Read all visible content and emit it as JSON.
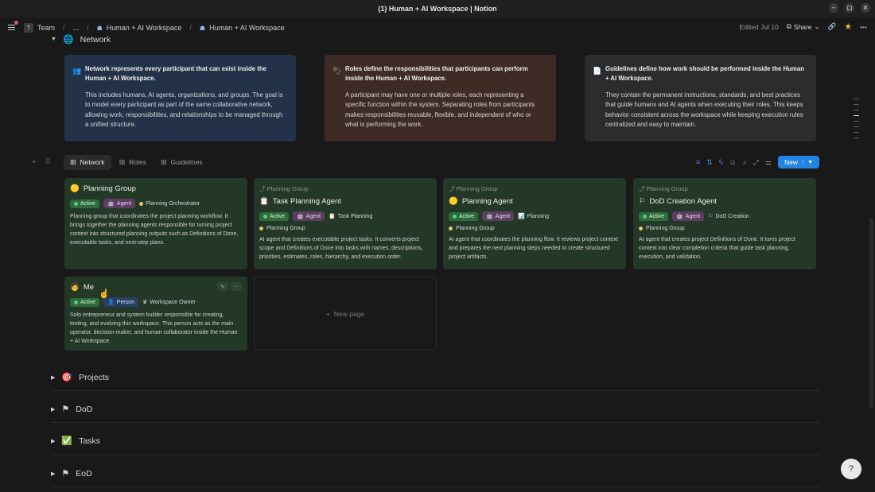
{
  "window": {
    "title": "(1) Human + AI Workspace | Notion"
  },
  "nav": {
    "team": "Team",
    "team_initial": "T",
    "ellipsis": "...",
    "crumb1": "Human + AI Workspace",
    "crumb2": "Human + AI Workspace",
    "edited": "Edited Jul 10",
    "share": "Share"
  },
  "network_section": {
    "label": "Network"
  },
  "callouts": [
    {
      "title": "Network represents every participant that can exist inside the Human + AI Workspace.",
      "body": "This includes humans, AI agents, organizations, and groups. The goal is to model every participant as part of the same collaborative network, allowing work, responsibilities, and relationships to be managed through a unified structure."
    },
    {
      "title": "Roles define the responsibilities that participants can perform inside the Human + AI Workspace.",
      "body": "A participant may have one or multiple roles, each representing a specific function within the system. Separating roles from participants makes responsibilities reusable, flexible, and independent of who or what is performing the work."
    },
    {
      "title": "Guidelines define how work should be performed inside the Human + AI Workspace.",
      "body": "They contain the permanent instructions, standards, and best practices that guide humans and AI agents when executing their roles. This keeps behavior consistent across the workspace while keeping execution rules centralized and easy to maintain."
    }
  ],
  "views": {
    "tab1": "Network",
    "tab2": "Roles",
    "tab3": "Guidelines",
    "new_button": "New"
  },
  "cards": [
    {
      "parent": "",
      "name": "Planning Group",
      "status": "Active",
      "type": "Agent",
      "role": "Planning Orchestrator",
      "group": "",
      "desc": "Planning group that coordinates the project planning workflow. It brings together the planning agents responsible for turning project context into structured planning outputs such as Definitions of Done, executable tasks, and next-step plans."
    },
    {
      "parent": "Planning Group",
      "name": "Task Planning Agent",
      "status": "Active",
      "type": "Agent",
      "role": "Task Planning",
      "group": "Planning Group",
      "desc": "AI agent that creates executable project tasks. It converts project scope and Definitions of Done into tasks with names, descriptions, priorities, estimates, roles, hierarchy, and execution order."
    },
    {
      "parent": "Planning Group",
      "name": "Planning Agent",
      "status": "Active",
      "type": "Agent",
      "role": "Planning",
      "group": "Planning Group",
      "desc": "AI agent that coordinates the planning flow. It reviews project context and prepares the next planning steps needed to create structured project artifacts."
    },
    {
      "parent": "Planning Group",
      "name": "DoD Creation Agent",
      "status": "Active",
      "type": "Agent",
      "role": "DoD Creation",
      "group": "Planning Group",
      "desc": "AI agent that creates project Definitions of Done. It turns project context into clear completion criteria that guide task planning, execution, and validation."
    },
    {
      "parent": "",
      "name": "Me",
      "status": "Active",
      "type": "Person",
      "role": "Workspace Owner",
      "group": "",
      "desc": "Solo entrepreneur and system builder responsible for creating, testing, and evolving this workspace. This person acts as the main operator, decision-maker, and human collaborator inside the Human + AI Workspace."
    }
  ],
  "new_page": "New page",
  "sections": [
    {
      "label": "Projects"
    },
    {
      "label": "DoD"
    },
    {
      "label": "Tasks"
    },
    {
      "label": "EoD"
    }
  ],
  "icons": {
    "network": "network-icon",
    "projects": "projects-icon",
    "dod": "dod-icon",
    "tasks": "check-icon",
    "eod": "eod-icon"
  },
  "colors": {
    "accent": "#2383e2",
    "card_bg": "#243828",
    "callout_blue": "#233249",
    "callout_brown": "#3e2b26"
  }
}
